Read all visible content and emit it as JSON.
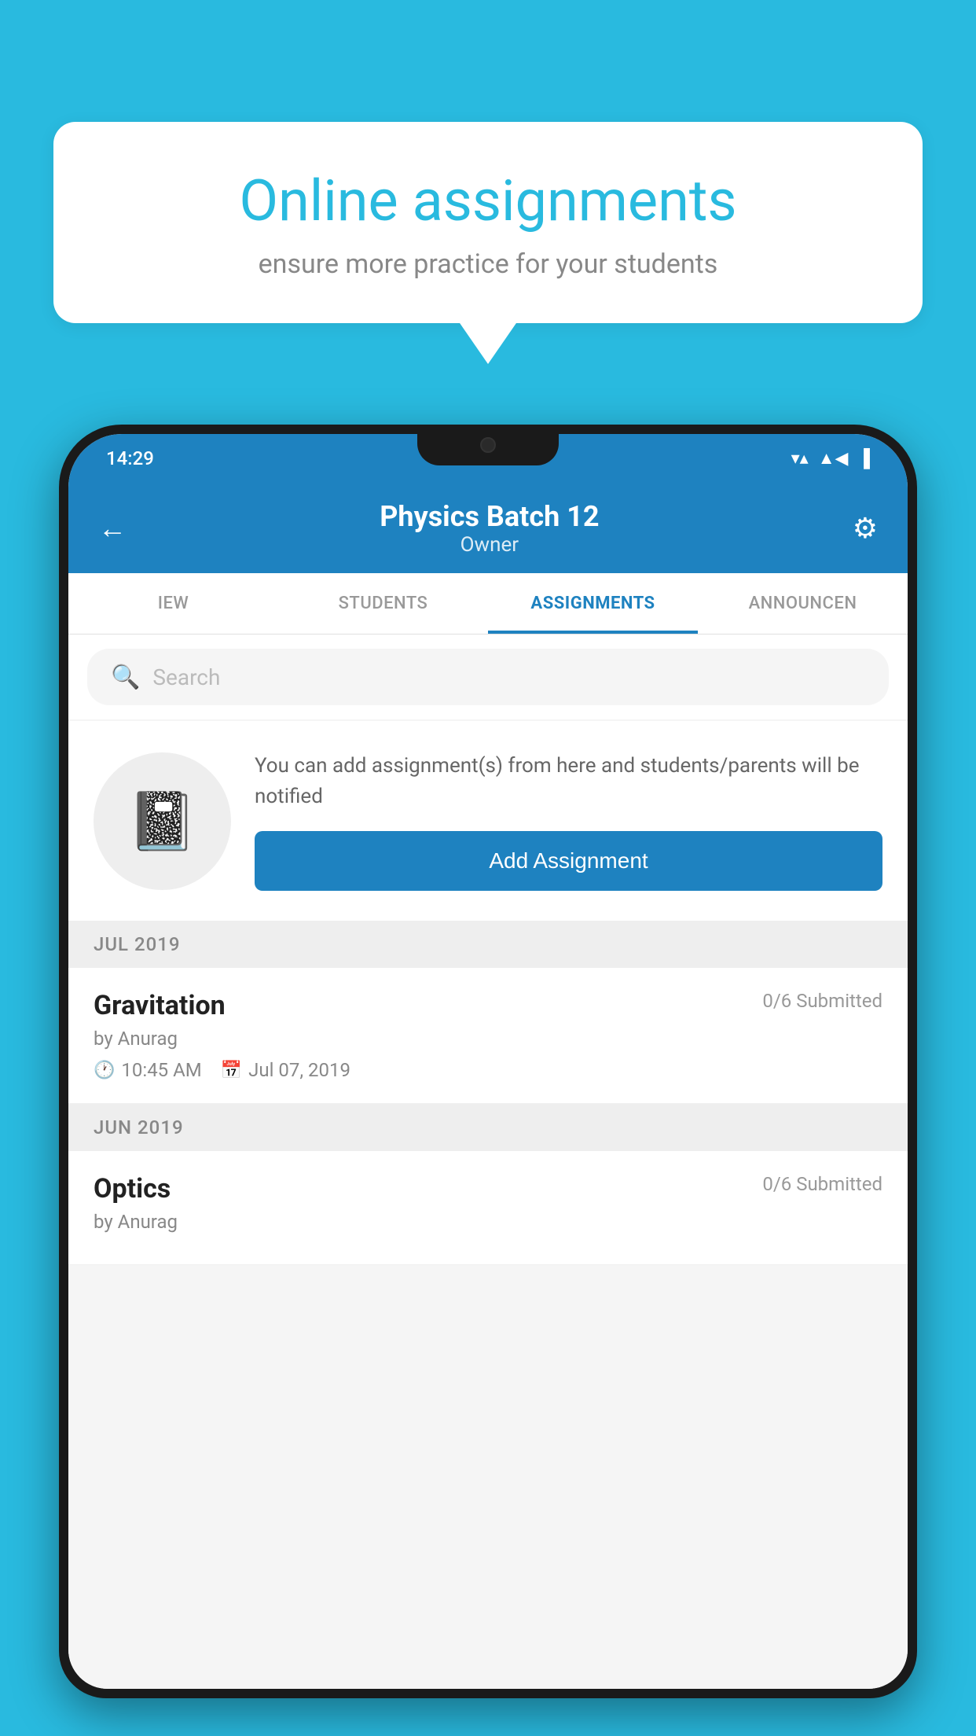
{
  "background_color": "#29BADF",
  "bubble": {
    "title": "Online assignments",
    "subtitle": "ensure more practice for your students"
  },
  "status_bar": {
    "time": "14:29",
    "wifi": "▼",
    "signal": "◀",
    "battery": "▮"
  },
  "header": {
    "title": "Physics Batch 12",
    "subtitle": "Owner",
    "back_label": "←",
    "settings_label": "⚙"
  },
  "tabs": [
    {
      "label": "IEW",
      "active": false
    },
    {
      "label": "STUDENTS",
      "active": false
    },
    {
      "label": "ASSIGNMENTS",
      "active": true
    },
    {
      "label": "ANNOUNCEN",
      "active": false
    }
  ],
  "search": {
    "placeholder": "Search"
  },
  "promo": {
    "text": "You can add assignment(s) from here and students/parents will be notified",
    "button_label": "Add Assignment"
  },
  "sections": [
    {
      "header": "JUL 2019",
      "assignments": [
        {
          "title": "Gravitation",
          "submitted": "0/6 Submitted",
          "by": "by Anurag",
          "time": "10:45 AM",
          "date": "Jul 07, 2019"
        }
      ]
    },
    {
      "header": "JUN 2019",
      "assignments": [
        {
          "title": "Optics",
          "submitted": "0/6 Submitted",
          "by": "by Anurag",
          "time": "",
          "date": ""
        }
      ]
    }
  ]
}
